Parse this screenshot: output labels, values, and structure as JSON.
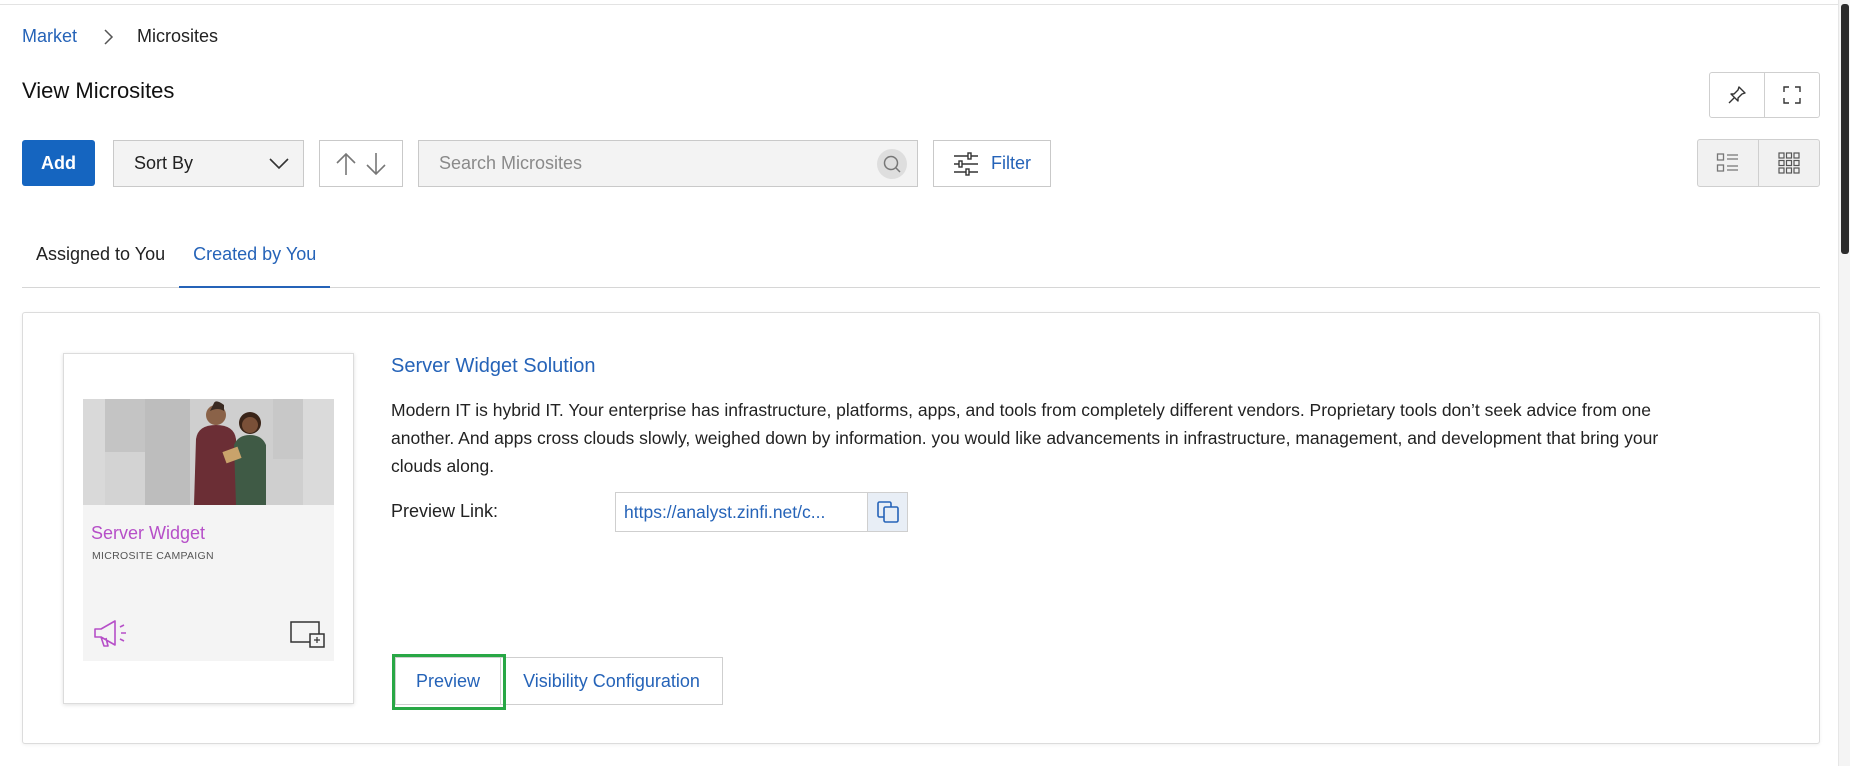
{
  "breadcrumb": {
    "parent": "Market",
    "current": "Microsites"
  },
  "page": {
    "title": "View Microsites"
  },
  "toolbar": {
    "add_label": "Add",
    "sort_label": "Sort By",
    "search_placeholder": "Search Microsites",
    "filter_label": "Filter"
  },
  "tabs": [
    {
      "label": "Assigned to You",
      "active": false
    },
    {
      "label": "Created by You",
      "active": true
    }
  ],
  "microsite": {
    "thumbnail": {
      "title": "Server Widget",
      "subtitle": "MICROSITE CAMPAIGN",
      "accent_color": "#b64fc8"
    },
    "title": "Server Widget Solution",
    "description": "Modern IT is hybrid IT. Your enterprise has infrastructure, platforms, apps, and tools from completely different vendors. Proprietary tools don’t seek advice from one another. And apps cross clouds slowly, weighed down by information. you would like advancements in infrastructure, management, and development that bring your clouds along.",
    "preview_link_label": "Preview Link:",
    "preview_link": "https://analyst.zinfi.net/c...",
    "actions": {
      "preview": "Preview",
      "visibility": "Visibility Configuration"
    }
  },
  "colors": {
    "primary": "#1565c0",
    "link": "#2563b8",
    "highlight": "#28a745"
  }
}
